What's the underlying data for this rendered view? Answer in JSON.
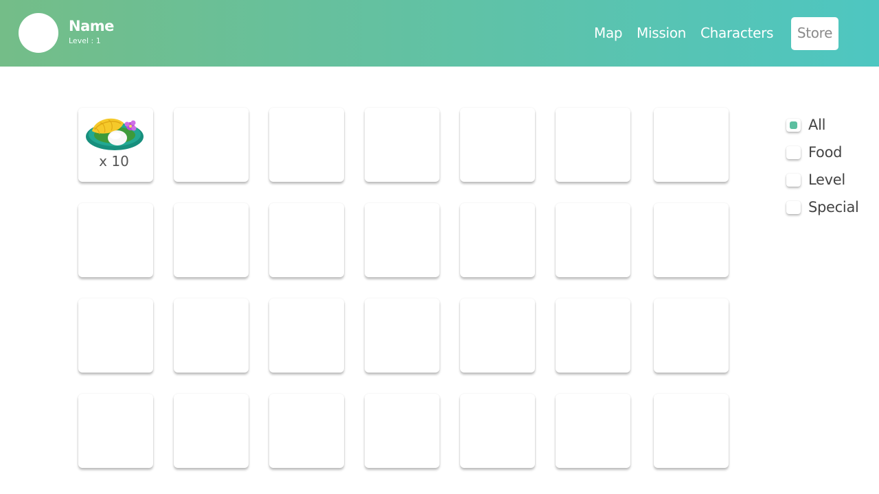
{
  "profile": {
    "name": "Name",
    "level": "Level : 1"
  },
  "nav": {
    "map": "Map",
    "mission": "Mission",
    "characters": "Characters",
    "store": "Store"
  },
  "inventory": {
    "items": [
      {
        "icon": "sticky-rice-mango-icon",
        "quantity": "x 10"
      }
    ]
  },
  "filters": [
    {
      "label": "All",
      "checked": true
    },
    {
      "label": "Food",
      "checked": false
    },
    {
      "label": "Level",
      "checked": false
    },
    {
      "label": "Special",
      "checked": false
    }
  ],
  "colors": {
    "header_start": "#74bd88",
    "header_end": "#4ec6c1",
    "check_active": "#5cbfa0"
  }
}
